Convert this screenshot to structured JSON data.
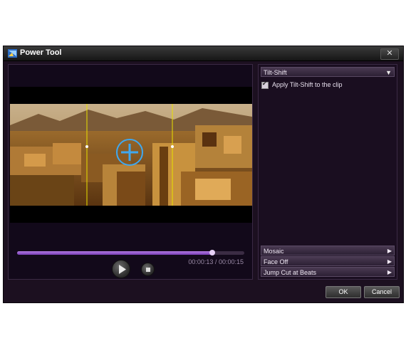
{
  "window": {
    "title": "Power Tool",
    "close_label": "✕"
  },
  "preview": {
    "current_time": "00:00:13",
    "separator": "/",
    "total_time": "00:00:15",
    "progress_fraction": 0.86
  },
  "effect_panel": {
    "selected_effect": "Tilt-Shift",
    "apply_label": "Apply Tilt-Shift to the clip",
    "apply_checked": true
  },
  "sections": [
    {
      "label": "Mosaic"
    },
    {
      "label": "Face Off"
    },
    {
      "label": "Jump Cut at Beats"
    }
  ],
  "buttons": {
    "ok": "OK",
    "cancel": "Cancel"
  },
  "icons": {
    "app": "power-tool-icon",
    "play": "play-icon",
    "stop": "stop-icon",
    "dropdown": "dropdown-arrow-icon",
    "expand": "expand-arrow-icon",
    "focus_target": "crosshair-target-icon"
  },
  "colors": {
    "accent_purple": "#8a4fc8",
    "guide_line": "#e8e000",
    "target_ring": "#3fa8f0"
  }
}
